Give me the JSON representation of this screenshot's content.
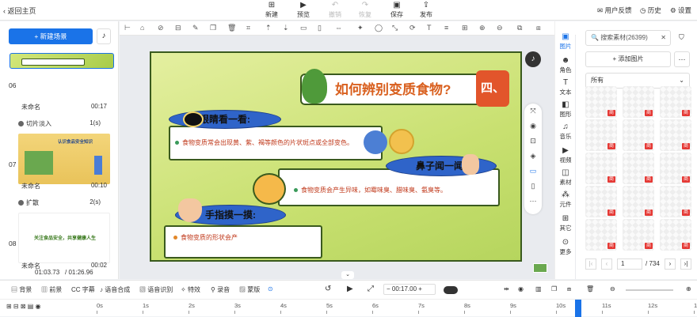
{
  "topbar": {
    "back": "返回主页",
    "new": "新建",
    "preview": "预览",
    "undo": "撤销",
    "redo": "恢复",
    "save": "保存",
    "publish": "发布",
    "feedback": "用户反馈",
    "history": "历史",
    "settings": "设置"
  },
  "left": {
    "new_scene": "+ 新建场景",
    "scenes": [
      {
        "num": "06",
        "name": "未命名",
        "duration": "00:17",
        "transition": "切片淡入",
        "trans_time": "1(s)"
      },
      {
        "num": "07",
        "name": "未命名",
        "duration": "00:10",
        "transition": "扩散",
        "trans_time": "2(s)"
      },
      {
        "num": "08",
        "name": "未命名",
        "duration": "00:02"
      }
    ],
    "thumb7_banner": "认识食品安全知识",
    "thumb8_text": "关注食品安全，共享健康人生",
    "time_current": "01:03.73",
    "time_total": "/ 01:26.96"
  },
  "slide": {
    "title": "如何辨别变质食物?",
    "badge": "四、",
    "section1_label": "眼睛看一看:",
    "section1_text": "食物变质常会出现黄、紫、褐等颜色的片状斑点或全部变色。",
    "section2_label": "鼻子闻一闻:",
    "section2_text": "食物变质会产生异味，如霉味臭、腊味臭、氨臭等。",
    "section3_label": "手指摸一摸:",
    "section3_text": "食物变质的形状会产"
  },
  "side_tabs": [
    "图片",
    "角色",
    "文本",
    "图形",
    "音乐",
    "视频",
    "素材",
    "元件",
    "其它",
    "更多"
  ],
  "right": {
    "search": "搜索素材(26399)",
    "add_image": "+ 添加图片",
    "filter": "所有",
    "page": "1",
    "pages": "/ 734",
    "badge": "商"
  },
  "bottom": {
    "items": [
      "背景",
      "前景",
      "字幕",
      "语音合成",
      "语音识别",
      "特效",
      "录音",
      "蒙版"
    ],
    "time": "00:17.00"
  },
  "timeline": [
    "0s",
    "1s",
    "2s",
    "3s",
    "4s",
    "5s",
    "6s",
    "7s",
    "8s",
    "9s",
    "10s",
    "11s",
    "12s",
    "13s"
  ]
}
